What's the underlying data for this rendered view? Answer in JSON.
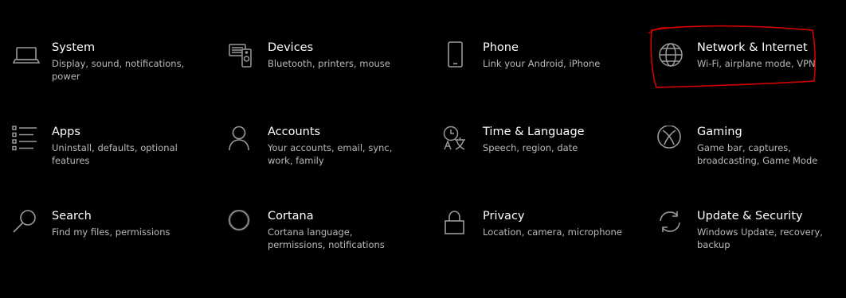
{
  "settings": {
    "tiles": [
      {
        "title": "System",
        "description": "Display, sound, notifications, power",
        "icon": "laptop-icon"
      },
      {
        "title": "Devices",
        "description": "Bluetooth, printers, mouse",
        "icon": "devices-icon"
      },
      {
        "title": "Phone",
        "description": "Link your Android, iPhone",
        "icon": "phone-icon"
      },
      {
        "title": "Network & Internet",
        "description": "Wi-Fi, airplane mode, VPN",
        "icon": "globe-icon"
      },
      {
        "title": "Apps",
        "description": "Uninstall, defaults, optional features",
        "icon": "apps-list-icon"
      },
      {
        "title": "Accounts",
        "description": "Your accounts, email, sync, work, family",
        "icon": "person-icon"
      },
      {
        "title": "Time & Language",
        "description": "Speech, region, date",
        "icon": "time-language-icon"
      },
      {
        "title": "Gaming",
        "description": "Game bar, captures, broadcasting, Game Mode",
        "icon": "xbox-icon"
      },
      {
        "title": "Search",
        "description": "Find my files, permissions",
        "icon": "search-icon"
      },
      {
        "title": "Cortana",
        "description": "Cortana language, permissions, notifications",
        "icon": "cortana-icon"
      },
      {
        "title": "Privacy",
        "description": "Location, camera, microphone",
        "icon": "lock-icon"
      },
      {
        "title": "Update & Security",
        "description": "Windows Update, recovery, backup",
        "icon": "sync-arrows-icon"
      }
    ]
  },
  "colors": {
    "background": "#000000",
    "title": "#ffffff",
    "description": "#b9b9b9",
    "icon": "#9a9a9a",
    "annotation": "#d40000"
  }
}
